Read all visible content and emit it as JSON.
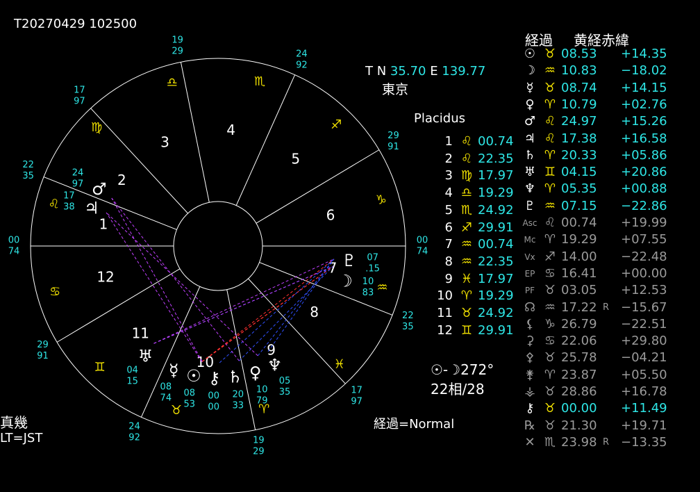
{
  "header": {
    "datetime": "T20270429 102500",
    "location_coords_label": "T N",
    "latitude": "35.70",
    "longitude_label": "E",
    "longitude": "139.77",
    "city": "東京"
  },
  "house_system": "Placidus",
  "houses": [
    {
      "num": "1",
      "sign": "♌",
      "deg": "00.74"
    },
    {
      "num": "2",
      "sign": "♌",
      "deg": "22.35"
    },
    {
      "num": "3",
      "sign": "♍",
      "deg": "17.97"
    },
    {
      "num": "4",
      "sign": "♎",
      "deg": "19.29"
    },
    {
      "num": "5",
      "sign": "♏",
      "deg": "24.92"
    },
    {
      "num": "6",
      "sign": "♐",
      "deg": "29.91"
    },
    {
      "num": "7",
      "sign": "♒",
      "deg": "00.74"
    },
    {
      "num": "8",
      "sign": "♒",
      "deg": "22.35"
    },
    {
      "num": "9",
      "sign": "♓",
      "deg": "17.97"
    },
    {
      "num": "10",
      "sign": "♈",
      "deg": "19.29"
    },
    {
      "num": "11",
      "sign": "♉",
      "deg": "24.92"
    },
    {
      "num": "12",
      "sign": "♊",
      "deg": "29.91"
    }
  ],
  "sun_moon": {
    "label": "☉-☽",
    "angle": "272°",
    "aspects": "22相/28"
  },
  "footer": {
    "left_title": "真幾",
    "timezone": "LT=JST",
    "transit_mode": "経過=Normal"
  },
  "table": {
    "header_transit": "経過",
    "header_coords": "黄経赤緯",
    "rows": [
      {
        "planet": "☉",
        "sign": "♉",
        "lon": "08.53",
        "r": "",
        "lat": "+14.35",
        "pc": "#ffffff",
        "vc": "#2ee6e6"
      },
      {
        "planet": "☽",
        "sign": "♒",
        "lon": "10.83",
        "r": "",
        "lat": "−18.02",
        "pc": "#ffffff",
        "vc": "#2ee6e6"
      },
      {
        "planet": "☿",
        "sign": "♉",
        "lon": "08.74",
        "r": "",
        "lat": "+14.15",
        "pc": "#ffffff",
        "vc": "#2ee6e6"
      },
      {
        "planet": "♀",
        "sign": "♈",
        "lon": "10.79",
        "r": "",
        "lat": "+02.76",
        "pc": "#ffffff",
        "vc": "#2ee6e6"
      },
      {
        "planet": "♂",
        "sign": "♌",
        "lon": "24.97",
        "r": "",
        "lat": "+15.26",
        "pc": "#ffffff",
        "vc": "#2ee6e6"
      },
      {
        "planet": "♃",
        "sign": "♌",
        "lon": "17.38",
        "r": "",
        "lat": "+16.58",
        "pc": "#ffffff",
        "vc": "#2ee6e6"
      },
      {
        "planet": "♄",
        "sign": "♈",
        "lon": "20.33",
        "r": "",
        "lat": "+05.86",
        "pc": "#ffffff",
        "vc": "#2ee6e6"
      },
      {
        "planet": "♅",
        "sign": "♊",
        "lon": "04.15",
        "r": "",
        "lat": "+20.86",
        "pc": "#ffffff",
        "vc": "#2ee6e6"
      },
      {
        "planet": "♆",
        "sign": "♈",
        "lon": "05.35",
        "r": "",
        "lat": "+00.88",
        "pc": "#ffffff",
        "vc": "#2ee6e6"
      },
      {
        "planet": "♇",
        "sign": "♒",
        "lon": "07.15",
        "r": "",
        "lat": "−22.86",
        "pc": "#ffffff",
        "vc": "#2ee6e6"
      },
      {
        "planet": "Asc",
        "sign": "♌",
        "lon": "00.74",
        "r": "",
        "lat": "+19.99",
        "pc": "#9a9a9a",
        "vc": "#9a9a9a"
      },
      {
        "planet": "Mc",
        "sign": "♈",
        "lon": "19.29",
        "r": "",
        "lat": "+07.55",
        "pc": "#9a9a9a",
        "vc": "#9a9a9a"
      },
      {
        "planet": "Vx",
        "sign": "♐",
        "lon": "14.00",
        "r": "",
        "lat": "−22.48",
        "pc": "#9a9a9a",
        "vc": "#9a9a9a"
      },
      {
        "planet": "EP",
        "sign": "♋",
        "lon": "16.41",
        "r": "",
        "lat": "+00.00",
        "pc": "#9a9a9a",
        "vc": "#9a9a9a"
      },
      {
        "planet": "PF",
        "sign": "♉",
        "lon": "03.05",
        "r": "",
        "lat": "+12.53",
        "pc": "#9a9a9a",
        "vc": "#9a9a9a"
      },
      {
        "planet": "☊",
        "sign": "♒",
        "lon": "17.22",
        "r": "R",
        "lat": "−15.67",
        "pc": "#9a9a9a",
        "vc": "#9a9a9a"
      },
      {
        "planet": "⚸",
        "sign": "♑",
        "lon": "26.79",
        "r": "",
        "lat": "−22.51",
        "pc": "#9a9a9a",
        "vc": "#9a9a9a"
      },
      {
        "planet": "⚳",
        "sign": "♋",
        "lon": "22.06",
        "r": "",
        "lat": "+29.80",
        "pc": "#9a9a9a",
        "vc": "#9a9a9a"
      },
      {
        "planet": "⚴",
        "sign": "♉",
        "lon": "25.78",
        "r": "",
        "lat": "−04.21",
        "pc": "#9a9a9a",
        "vc": "#9a9a9a"
      },
      {
        "planet": "⚵",
        "sign": "♈",
        "lon": "23.87",
        "r": "",
        "lat": "+05.50",
        "pc": "#9a9a9a",
        "vc": "#9a9a9a"
      },
      {
        "planet": "⚶",
        "sign": "♉",
        "lon": "28.86",
        "r": "",
        "lat": "+16.78",
        "pc": "#9a9a9a",
        "vc": "#9a9a9a"
      },
      {
        "planet": "⚷",
        "sign": "♉",
        "lon": "00.00",
        "r": "",
        "lat": "+11.49",
        "pc": "#ffffff",
        "vc": "#2ee6e6"
      },
      {
        "planet": "℞",
        "sign": "♉",
        "lon": "21.30",
        "r": "",
        "lat": "+19.71",
        "pc": "#9a9a9a",
        "vc": "#9a9a9a"
      },
      {
        "planet": "✕",
        "sign": "♏",
        "lon": "23.98",
        "r": "R",
        "lat": "−13.35",
        "pc": "#9a9a9a",
        "vc": "#9a9a9a"
      }
    ]
  },
  "wheel": {
    "ascendant_lon": 120.74,
    "cusps": [
      120.74,
      142.35,
      167.97,
      199.29,
      234.92,
      269.91,
      300.74,
      322.35,
      347.97,
      19.29,
      54.92,
      89.91
    ],
    "house_labels": [
      "1",
      "2",
      "3",
      "4",
      "5",
      "6",
      "7",
      "8",
      "9",
      "10",
      "11",
      "12"
    ],
    "sign_glyphs": [
      "♈",
      "♉",
      "♊",
      "♋",
      "♌",
      "♍",
      "♎",
      "♏",
      "♐",
      "♑",
      "♒",
      "♓"
    ],
    "cusp_deg_labels": [
      {
        "top": "00",
        "bottom": "74"
      },
      {
        "top": "22",
        "bottom": "35"
      },
      {
        "top": "17",
        "bottom": "97"
      },
      {
        "top": "19",
        "bottom": "29"
      },
      {
        "top": "24",
        "bottom": "92"
      },
      {
        "top": "29",
        "bottom": "91"
      },
      {
        "top": "00",
        "bottom": "74"
      },
      {
        "top": "22",
        "bottom": "35"
      },
      {
        "top": "17",
        "bottom": "97"
      },
      {
        "top": "19",
        "bottom": "29"
      },
      {
        "top": "24",
        "bottom": "92"
      },
      {
        "top": "29",
        "bottom": "91"
      }
    ],
    "planets": [
      {
        "glyph": "☉",
        "lon": 38.53,
        "top": "08",
        "bottom": "53"
      },
      {
        "glyph": "☽",
        "lon": 310.83,
        "top": "10",
        "bottom": "83"
      },
      {
        "glyph": "☿",
        "lon": 38.74,
        "top": "08",
        "bottom": "74"
      },
      {
        "glyph": "♀",
        "lon": 10.79,
        "top": "10",
        "bottom": "79"
      },
      {
        "glyph": "♂",
        "lon": 144.97,
        "top": "24",
        "bottom": "97"
      },
      {
        "glyph": "♃",
        "lon": 137.38,
        "top": "17",
        "bottom": "38"
      },
      {
        "glyph": "♄",
        "lon": 20.33,
        "top": "20",
        "bottom": "33"
      },
      {
        "glyph": "♅",
        "lon": 64.15,
        "top": "04",
        "bottom": "15"
      },
      {
        "glyph": "♆",
        "lon": 5.35,
        "top": "05",
        "bottom": "35"
      },
      {
        "glyph": "♇",
        "lon": 307.15,
        "top": "07",
        "bottom": ".15"
      },
      {
        "glyph": "⚷",
        "lon": 30.0,
        "top": "00",
        "bottom": "00"
      }
    ],
    "aspects": [
      {
        "a": 0,
        "b": 1,
        "color": "#ff3030"
      },
      {
        "a": 2,
        "b": 1,
        "color": "#ff3030"
      },
      {
        "a": 0,
        "b": 9,
        "color": "#ff3030"
      },
      {
        "a": 3,
        "b": 9,
        "color": "#3050ff"
      },
      {
        "a": 6,
        "b": 1,
        "color": "#3050ff"
      },
      {
        "a": 8,
        "b": 9,
        "color": "#3050ff"
      },
      {
        "a": 7,
        "b": 1,
        "color": "#3050ff"
      },
      {
        "a": 10,
        "b": 9,
        "color": "#3050ff"
      },
      {
        "a": 0,
        "b": 4,
        "color": "#c040ff"
      },
      {
        "a": 2,
        "b": 5,
        "color": "#c040ff"
      },
      {
        "a": 3,
        "b": 5,
        "color": "#c040ff"
      },
      {
        "a": 6,
        "b": 4,
        "color": "#c040ff"
      },
      {
        "a": 7,
        "b": 1,
        "color": "#c040ff"
      },
      {
        "a": 7,
        "b": 9,
        "color": "#c040ff"
      }
    ]
  }
}
